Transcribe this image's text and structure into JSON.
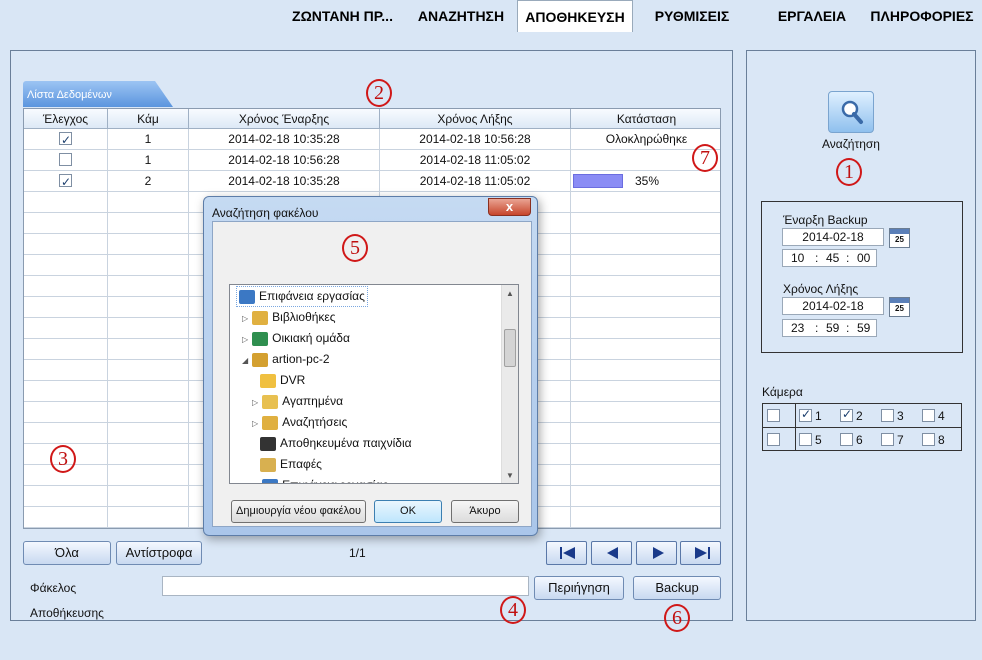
{
  "tabs": [
    {
      "label": "ΖΩΝΤΑΝΗ ΠΡ..."
    },
    {
      "label": "ΑΝΑΖΗΤΗΣΗ"
    },
    {
      "label": "ΑΠΟΘΗΚΕΥΣΗ"
    },
    {
      "label": "ΡΥΘΜΙΣΕΙΣ"
    },
    {
      "label": "ΕΡΓΑΛΕΙΑ"
    },
    {
      "label": "ΠΛΗΡΟΦΟΡΙΕΣ"
    }
  ],
  "list": {
    "title": "Λίστα Δεδομένων",
    "columns": [
      "Έλεγχος",
      "Κάμ",
      "Χρόνος Έναρξης",
      "Χρόνος Λήξης",
      "Κατάσταση"
    ],
    "rows": [
      {
        "checked": true,
        "cam": "1",
        "start": "2014-02-18 10:35:28",
        "end": "2014-02-18 10:56:28",
        "status": "Ολοκληρώθηκε"
      },
      {
        "checked": false,
        "cam": "1",
        "start": "2014-02-18 10:56:28",
        "end": "2014-02-18 11:05:02",
        "status": ""
      },
      {
        "checked": true,
        "cam": "2",
        "start": "2014-02-18 10:35:28",
        "end": "2014-02-18 11:05:02",
        "status": "35%",
        "progress": 0.35
      }
    ]
  },
  "controls": {
    "all_label": "Όλα",
    "invert_label": "Αντίστροφα",
    "page": "1/1",
    "folder_label_1": "Φάκελος",
    "folder_label_2": "Αποθήκευσης",
    "folder_value": "",
    "browse_label": "Περιήγηση",
    "backup_label": "Backup"
  },
  "dialog": {
    "title": "Αναζήτηση φακέλου",
    "close": "x",
    "tree": [
      {
        "label": "Επιφάνεια εργασίας",
        "icon": "desktop-icon"
      },
      {
        "label": "Βιβλιοθήκες",
        "icon": "libraries-icon"
      },
      {
        "label": "Οικιακή ομάδα",
        "icon": "homegroup-icon"
      },
      {
        "label": "artion-pc-2",
        "icon": "user-folder-icon"
      },
      {
        "label": "DVR",
        "icon": "folder-icon"
      },
      {
        "label": "Αγαπημένα",
        "icon": "favorites-icon"
      },
      {
        "label": "Αναζητήσεις",
        "icon": "searches-icon"
      },
      {
        "label": "Αποθηκευμένα παιχνίδια",
        "icon": "saved-games-icon"
      },
      {
        "label": "Επαφές",
        "icon": "contacts-icon"
      },
      {
        "label": "Επιφάνεια εργασίας",
        "icon": "desktop-folder-icon"
      }
    ],
    "new_folder_label": "Δημιουργία νέου φακέλου",
    "ok_label": "OK",
    "cancel_label": "Άκυρο"
  },
  "side": {
    "search_label": "Αναζήτηση",
    "start_label": "Έναρξη Backup",
    "start_date": "2014-02-18",
    "start_h": "10",
    "start_m": "45",
    "start_s": "00",
    "end_label": "Χρόνος Λήξης",
    "end_date": "2014-02-18",
    "end_h": "23",
    "end_m": "59",
    "end_s": "59",
    "cal_day": "25",
    "time_sep": ":",
    "camera_label": "Κάμερα",
    "cameras": [
      {
        "n": "1",
        "checked": true
      },
      {
        "n": "2",
        "checked": true
      },
      {
        "n": "3",
        "checked": false
      },
      {
        "n": "4",
        "checked": false
      },
      {
        "n": "5",
        "checked": false
      },
      {
        "n": "6",
        "checked": false
      },
      {
        "n": "7",
        "checked": false
      },
      {
        "n": "8",
        "checked": false
      }
    ]
  },
  "callouts": [
    "1",
    "2",
    "3",
    "4",
    "5",
    "6",
    "7"
  ],
  "colors": {
    "accent": "#5b95de",
    "callout": "#d01818",
    "progress": "#8a8cf5"
  }
}
